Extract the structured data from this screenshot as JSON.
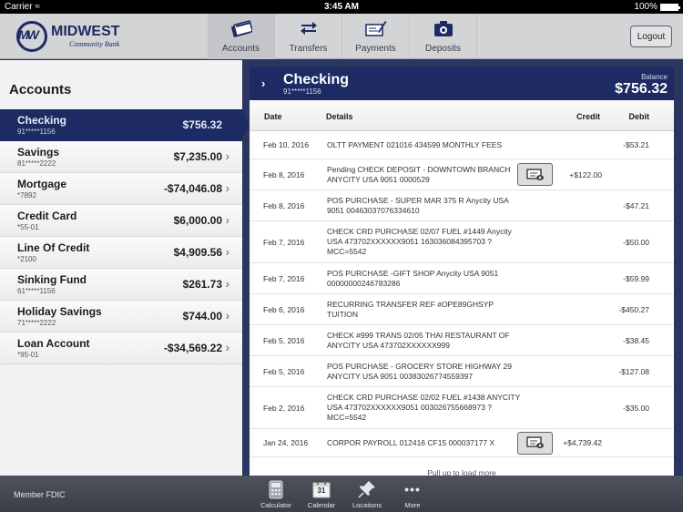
{
  "status_bar": {
    "carrier": "Carrier",
    "time": "3:45 AM",
    "battery": "100%"
  },
  "header": {
    "logo": {
      "mark": "MW",
      "name": "MIDWEST",
      "subtitle": "Community Bank"
    },
    "nav": [
      {
        "label": "Accounts",
        "icon": "credit-card-icon",
        "active": true
      },
      {
        "label": "Transfers",
        "icon": "transfer-arrows-icon",
        "active": false
      },
      {
        "label": "Payments",
        "icon": "check-pen-icon",
        "active": false
      },
      {
        "label": "Deposits",
        "icon": "camera-icon",
        "active": false
      }
    ],
    "logout_label": "Logout"
  },
  "sidebar": {
    "title": "Accounts",
    "accounts": [
      {
        "name": "Checking",
        "number": "91*****1156",
        "balance": "$756.32",
        "selected": true
      },
      {
        "name": "Savings",
        "number": "81*****2222",
        "balance": "$7,235.00"
      },
      {
        "name": "Mortgage",
        "number": "*7892",
        "balance": "-$74,046.08"
      },
      {
        "name": "Credit Card",
        "number": "*55-01",
        "balance": "$6,000.00"
      },
      {
        "name": "Line Of Credit",
        "number": "*2100",
        "balance": "$4,909.56"
      },
      {
        "name": "Sinking Fund",
        "number": "61*****1156",
        "balance": "$261.73"
      },
      {
        "name": "Holiday Savings",
        "number": "71*****2222",
        "balance": "$744.00"
      },
      {
        "name": "Loan Account",
        "number": "*95-01",
        "balance": "-$34,569.22"
      }
    ]
  },
  "panel": {
    "title": "Checking",
    "account_number": "91*****1156",
    "balance_label": "Balance",
    "balance": "$756.32",
    "columns": {
      "date": "Date",
      "details": "Details",
      "credit": "Credit",
      "debit": "Debit"
    },
    "transactions": [
      {
        "date": "Feb 10, 2016",
        "details": "OLTT PAYMENT 021016 434599 MONTHLY FEES",
        "credit": "",
        "debit": "-$53.21",
        "has_image": false
      },
      {
        "date": "Feb 8, 2016",
        "details": "Pending CHECK DEPOSIT - DOWNTOWN BRANCH ANYCITY USA 9051 0000529",
        "credit": "+$122.00",
        "debit": "",
        "has_image": true
      },
      {
        "date": "Feb 8, 2016",
        "details": "POS PURCHASE -  SUPER MAR 375 R Anycity USA 9051 00463037076334610",
        "credit": "",
        "debit": "-$47.21",
        "has_image": false
      },
      {
        "date": "Feb 7, 2016",
        "details": "CHECK CRD PURCHASE 02/07  FUEL #1449 Anycity USA 473702XXXXXX9051 163036084395703 ?MCC=5542",
        "credit": "",
        "debit": "-$50.00",
        "has_image": false
      },
      {
        "date": "Feb 7, 2016",
        "details": "POS PURCHASE -GIFT SHOP Anycity USA 9051 00000000246783286",
        "credit": "",
        "debit": "-$59.99",
        "has_image": false
      },
      {
        "date": "Feb 6, 2016",
        "details": "RECURRING TRANSFER REF #OPE89GHSYP TUITION",
        "credit": "",
        "debit": "-$450.27",
        "has_image": false
      },
      {
        "date": "Feb 5, 2016",
        "details": "CHECK #999 TRANS 02/05 THAI RESTAURANT OF ANYCITY USA 473702XXXXXX999",
        "credit": "",
        "debit": "-$38.45",
        "has_image": false
      },
      {
        "date": "Feb 5, 2016",
        "details": "POS PURCHASE - GROCERY STORE HIGHWAY 29 ANYCITY USA 9051 00383026774559397",
        "credit": "",
        "debit": "-$127.08",
        "has_image": false
      },
      {
        "date": "Feb 2, 2016",
        "details": "CHECK CRD PURCHASE 02/02 FUEL #1438 ANYCITY USA 473702XXXXXX9051 003026755668973 ?MCC=5542",
        "credit": "",
        "debit": "-$35.00",
        "has_image": false
      },
      {
        "date": "Jan 24, 2016",
        "details": "CORPOR PAYROLL 012416 CF15 000037177 X",
        "credit": "+$4,739.42",
        "debit": "",
        "has_image": true
      }
    ],
    "load_more": "Pull up to load more"
  },
  "footer": {
    "fdic": "Member FDIC",
    "tools": [
      {
        "label": "Calculator",
        "icon": "calculator-icon"
      },
      {
        "label": "Calendar",
        "icon": "calendar-icon",
        "day": "31"
      },
      {
        "label": "Locations",
        "icon": "pushpin-icon"
      },
      {
        "label": "More",
        "icon": "more-dots-icon"
      }
    ]
  }
}
